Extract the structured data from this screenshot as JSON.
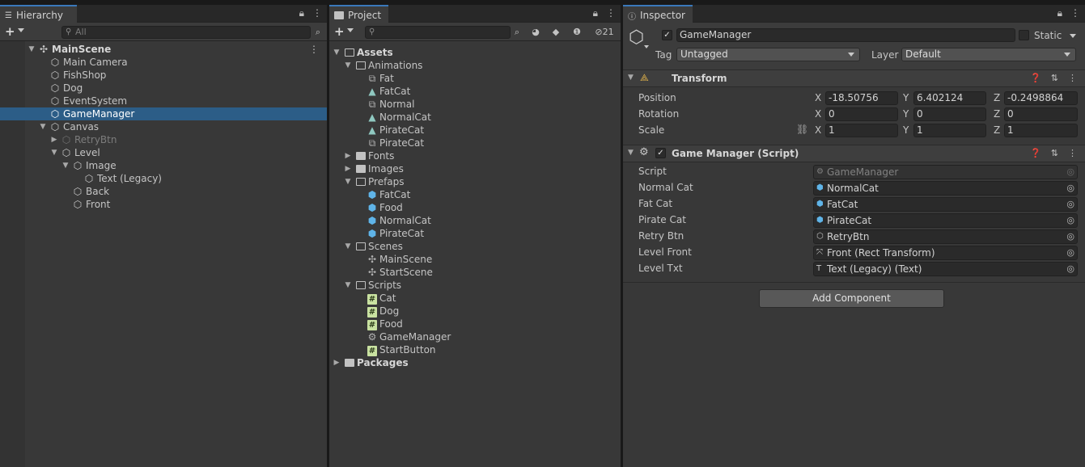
{
  "hierarchy": {
    "tab_label": "Hierarchy",
    "search_placeholder": "All",
    "items": [
      {
        "label": "MainScene",
        "kind": "scene",
        "depth": 0,
        "expanded": true
      },
      {
        "label": "Main Camera",
        "kind": "gameobject",
        "depth": 1
      },
      {
        "label": "FishShop",
        "kind": "gameobject",
        "depth": 1
      },
      {
        "label": "Dog",
        "kind": "gameobject",
        "depth": 1
      },
      {
        "label": "EventSystem",
        "kind": "gameobject",
        "depth": 1
      },
      {
        "label": "GameManager",
        "kind": "gameobject",
        "depth": 1,
        "selected": true
      },
      {
        "label": "Canvas",
        "kind": "gameobject",
        "depth": 1,
        "expanded": true
      },
      {
        "label": "RetryBtn",
        "kind": "gameobject",
        "depth": 2,
        "inactive": true,
        "collapsed": true
      },
      {
        "label": "Level",
        "kind": "gameobject",
        "depth": 2,
        "expanded": true
      },
      {
        "label": "Image",
        "kind": "gameobject",
        "depth": 3,
        "expanded": true
      },
      {
        "label": "Text (Legacy)",
        "kind": "gameobject",
        "depth": 4
      },
      {
        "label": "Back",
        "kind": "gameobject",
        "depth": 3
      },
      {
        "label": "Front",
        "kind": "gameobject",
        "depth": 3
      }
    ]
  },
  "project": {
    "tab_label": "Project",
    "hidden_count": "21",
    "items": [
      {
        "label": "Assets",
        "kind": "folder-open",
        "depth": 0,
        "bold": true
      },
      {
        "label": "Animations",
        "kind": "folder-open",
        "depth": 1
      },
      {
        "label": "Fat",
        "kind": "controller",
        "depth": 2
      },
      {
        "label": "FatCat",
        "kind": "anim",
        "depth": 2
      },
      {
        "label": "Normal",
        "kind": "controller",
        "depth": 2
      },
      {
        "label": "NormalCat",
        "kind": "anim",
        "depth": 2
      },
      {
        "label": "PirateCat",
        "kind": "anim",
        "depth": 2
      },
      {
        "label": "PirateCat",
        "kind": "controller",
        "depth": 2
      },
      {
        "label": "Fonts",
        "kind": "folder",
        "depth": 1
      },
      {
        "label": "Images",
        "kind": "folder",
        "depth": 1
      },
      {
        "label": "Prefaps",
        "kind": "folder-open",
        "depth": 1
      },
      {
        "label": "FatCat",
        "kind": "prefab",
        "depth": 2
      },
      {
        "label": "Food",
        "kind": "prefab",
        "depth": 2
      },
      {
        "label": "NormalCat",
        "kind": "prefab",
        "depth": 2
      },
      {
        "label": "PirateCat",
        "kind": "prefab",
        "depth": 2
      },
      {
        "label": "Scenes",
        "kind": "folder-open",
        "depth": 1
      },
      {
        "label": "MainScene",
        "kind": "scene",
        "depth": 2
      },
      {
        "label": "StartScene",
        "kind": "scene",
        "depth": 2
      },
      {
        "label": "Scripts",
        "kind": "folder-open",
        "depth": 1
      },
      {
        "label": "Cat",
        "kind": "script",
        "depth": 2
      },
      {
        "label": "Dog",
        "kind": "script",
        "depth": 2
      },
      {
        "label": "Food",
        "kind": "script",
        "depth": 2
      },
      {
        "label": "GameManager",
        "kind": "gear",
        "depth": 2
      },
      {
        "label": "StartButton",
        "kind": "script",
        "depth": 2
      },
      {
        "label": "Packages",
        "kind": "folder",
        "depth": 0,
        "bold": true
      }
    ]
  },
  "inspector": {
    "tab_label": "Inspector",
    "object_name": "GameManager",
    "static_label": "Static",
    "tag_label": "Tag",
    "tag_value": "Untagged",
    "layer_label": "Layer",
    "layer_value": "Default",
    "transform": {
      "title": "Transform",
      "position_label": "Position",
      "rotation_label": "Rotation",
      "scale_label": "Scale",
      "axes": [
        "X",
        "Y",
        "Z"
      ],
      "position": [
        "-18.50756",
        "6.402124",
        "-0.2498864"
      ],
      "rotation": [
        "0",
        "0",
        "0"
      ],
      "scale": [
        "1",
        "1",
        "1"
      ]
    },
    "script_component": {
      "title": "Game Manager (Script)",
      "fields": [
        {
          "label": "Script",
          "value": "GameManager",
          "icon": "script-asset-icon",
          "disabled": true
        },
        {
          "label": "Normal Cat",
          "value": "NormalCat",
          "icon": "prefab-icon"
        },
        {
          "label": "Fat Cat",
          "value": "FatCat",
          "icon": "prefab-icon"
        },
        {
          "label": "Pirate Cat",
          "value": "PirateCat",
          "icon": "prefab-icon"
        },
        {
          "label": "Retry Btn",
          "value": "RetryBtn",
          "icon": "gameobject-icon"
        },
        {
          "label": "Level Front",
          "value": "Front (Rect Transform)",
          "icon": "rect-transform-icon"
        },
        {
          "label": "Level Txt",
          "value": "Text (Legacy) (Text)",
          "icon": "text-component-icon"
        }
      ]
    },
    "add_component_label": "Add Component"
  },
  "colors": {
    "selection": "#2c5d87",
    "tab_accent": "#3a79bb",
    "prefab_blue": "#5fb4e8"
  }
}
